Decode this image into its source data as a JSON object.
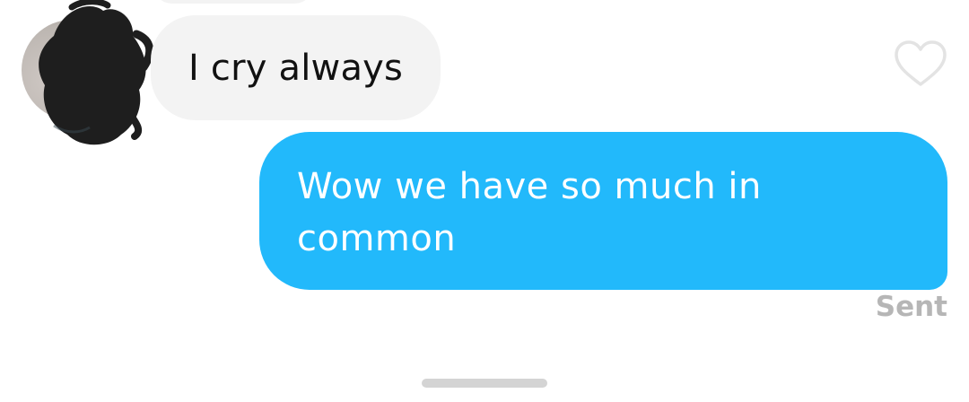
{
  "conversation": {
    "messages": [
      {
        "direction": "incoming",
        "text": "I cry always"
      },
      {
        "direction": "outgoing",
        "text": "Wow we have so much in common"
      }
    ],
    "sent_status": "Sent"
  },
  "icons": {
    "like": "heart-outline-icon",
    "avatar": "avatar"
  },
  "colors": {
    "incoming_bubble": "#f3f3f3",
    "outgoing_bubble": "#22b9fb",
    "status_text": "#b6b6b6"
  }
}
